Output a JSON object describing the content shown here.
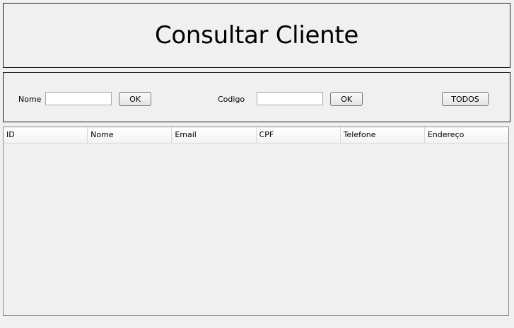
{
  "title": "Consultar Cliente",
  "search": {
    "name_label": "Nome",
    "name_value": "",
    "name_ok": "OK",
    "code_label": "Codigo",
    "code_value": "",
    "code_ok": "OK",
    "all_button": "TODOS"
  },
  "table": {
    "columns": [
      "ID",
      "Nome",
      "Email",
      "CPF",
      "Telefone",
      "Endereço"
    ],
    "rows": []
  }
}
